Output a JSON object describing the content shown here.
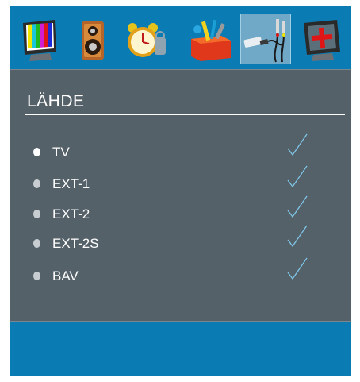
{
  "menu": {
    "tabs": [
      {
        "name": "picture",
        "icon": "tv-colorbars-icon"
      },
      {
        "name": "sound",
        "icon": "speaker-icon"
      },
      {
        "name": "timer",
        "icon": "alarm-clock-icon"
      },
      {
        "name": "features",
        "icon": "toolbox-icon"
      },
      {
        "name": "source",
        "icon": "av-cables-icon",
        "selected": true
      },
      {
        "name": "install",
        "icon": "monitor-cross-icon"
      }
    ]
  },
  "panel": {
    "title": "LÄHDE",
    "sources": [
      {
        "label": "TV",
        "active": true,
        "enabled": true
      },
      {
        "label": "EXT-1",
        "active": false,
        "enabled": true
      },
      {
        "label": "EXT-2",
        "active": false,
        "enabled": true
      },
      {
        "label": "EXT-2S",
        "active": false,
        "enabled": true
      },
      {
        "label": "BAV",
        "active": false,
        "enabled": true
      }
    ]
  },
  "colors": {
    "frame": "#0b7bb3",
    "panel": "#556169",
    "check": "#7fc6e8",
    "selected_tab": "#6fa9c7"
  }
}
